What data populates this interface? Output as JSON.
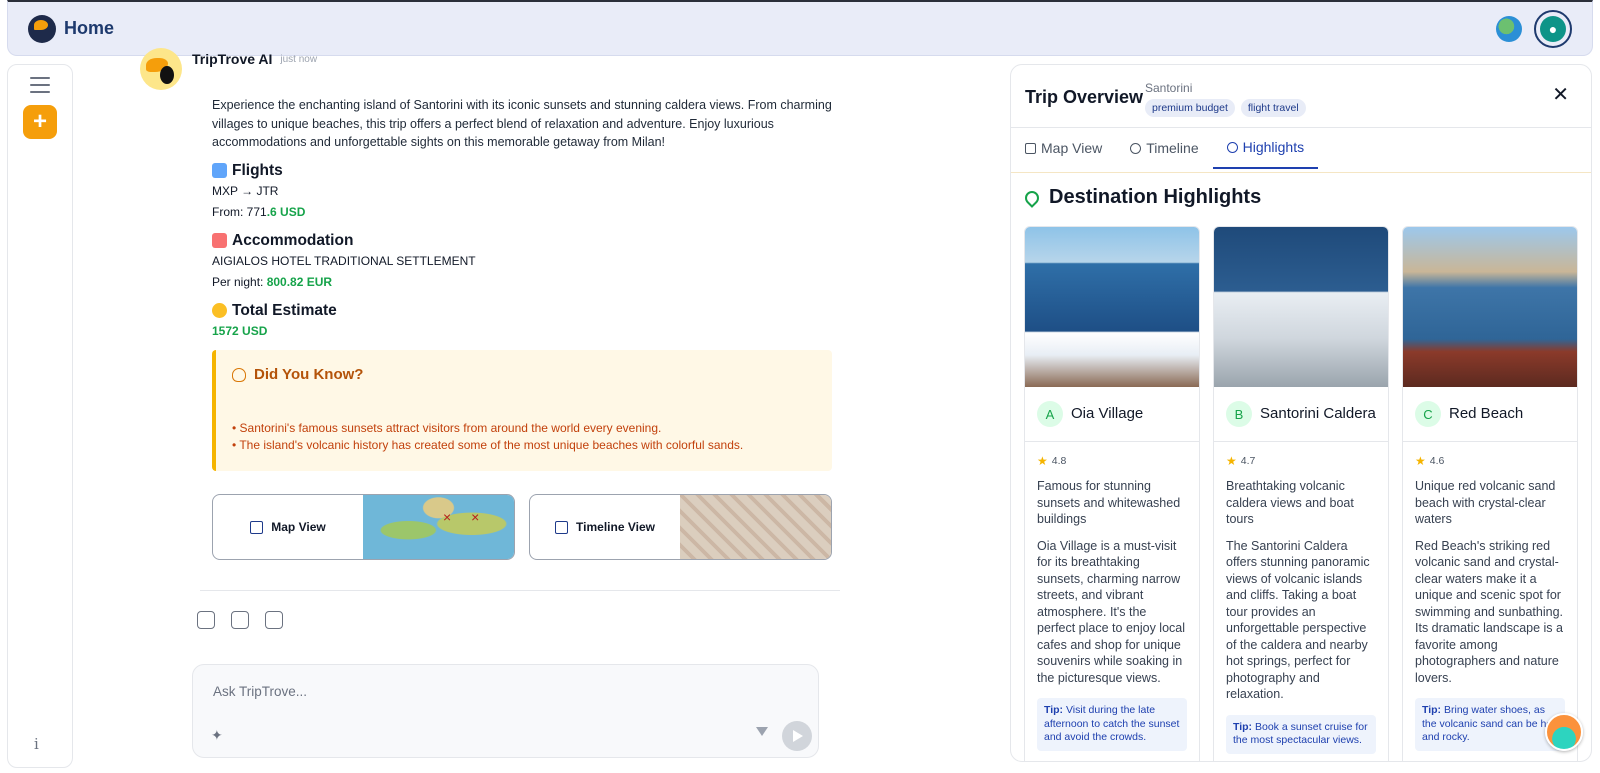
{
  "header": {
    "title": "Home"
  },
  "message": {
    "author": "TripTrove AI",
    "time": "just now",
    "intro": "Experience the enchanting island of Santorini with its iconic sunsets and stunning caldera views. From charming villages to unique beaches, this trip offers a perfect blend of relaxation and adventure. Enjoy luxurious accommodations and unforgettable sights on this memorable getaway from Milan!",
    "flights": {
      "title": "Flights",
      "route": "MXP → JTR",
      "from_label": "From: 771",
      "from_value": ".6 USD"
    },
    "accommodation": {
      "title": "Accommodation",
      "hotel": "AIGIALOS HOTEL TRADITIONAL SETTLEMENT",
      "per_night_label": "Per night: ",
      "per_night_value": "800.82 EUR"
    },
    "total": {
      "title": "Total Estimate",
      "value": "1572 USD"
    },
    "did_you_know": {
      "title": "Did You Know?",
      "facts": [
        "Santorini's famous sunsets attract visitors from around the world every evening.",
        "The island's volcanic history has created some of the most unique beaches with colorful sands."
      ]
    },
    "map_view_label": "Map View",
    "timeline_view_label": "Timeline View"
  },
  "composer": {
    "placeholder": "Ask TripTrove..."
  },
  "panel": {
    "title": "Trip Overview",
    "destination": "Santorini",
    "tags": [
      "premium budget",
      "flight travel"
    ],
    "tabs": [
      "Map View",
      "Timeline",
      "Highlights"
    ],
    "active_tab": "Highlights",
    "section_title": "Destination Highlights",
    "highlights": [
      {
        "letter": "A",
        "name": "Oia Village",
        "rating": "4.8",
        "short": "Famous for stunning sunsets and whitewashed buildings",
        "long": "Oia Village is a must-visit for its breathtaking sunsets, charming narrow streets, and vibrant atmosphere. It's the perfect place to enjoy local cafes and shop for unique souvenirs while soaking in the picturesque views.",
        "tip": "Visit during the late afternoon to catch the sunset and avoid the crowds."
      },
      {
        "letter": "B",
        "name": "Santorini Caldera",
        "rating": "4.7",
        "short": "Breathtaking volcanic caldera views and boat tours",
        "long": "The Santorini Caldera offers stunning panoramic views of volcanic islands and cliffs. Taking a boat tour provides an unforgettable perspective of the caldera and nearby hot springs, perfect for photography and relaxation.",
        "tip": "Book a sunset cruise for the most spectacular views."
      },
      {
        "letter": "C",
        "name": "Red Beach",
        "rating": "4.6",
        "short": "Unique red volcanic sand beach with crystal-clear waters",
        "long": "Red Beach's striking red volcanic sand and crystal-clear waters make it a unique and scenic spot for swimming and sunbathing. Its dramatic landscape is a favorite among photographers and nature lovers.",
        "tip": "Bring water shoes, as the volcanic sand can be hot and rocky."
      }
    ],
    "tip_label": "Tip:"
  },
  "colors": {
    "accent": "#f59e0b",
    "primary": "#1e40af",
    "success": "#16a34a",
    "warning_text": "#c2410c"
  }
}
